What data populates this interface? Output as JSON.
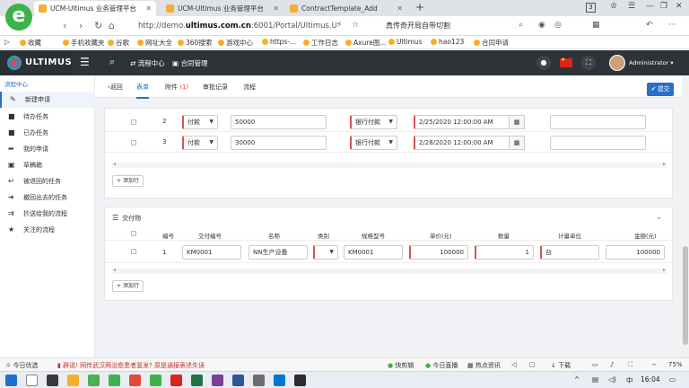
{
  "browser": {
    "tabs": [
      {
        "title": "UCM-Ultimus 业务管理平台",
        "active": true
      },
      {
        "title": "UCM-Ultimus 业务管理平台",
        "active": false
      },
      {
        "title": "ContractTemplate_Add",
        "active": false
      }
    ],
    "new_tab": "+",
    "tab_count": "3",
    "url_prefix": "http://demo.",
    "url_domain": "ultimus.com.cn",
    "url_rest": ":6001/Portal/Ultimus.U",
    "search_text": "真传奇开局自带切割",
    "bookmarks": [
      "收藏",
      "手机收藏夹",
      "谷歌",
      "网址大全",
      "360搜索",
      "游戏中心",
      "https-...",
      "工作日志",
      "Axure图...",
      "Ultimus",
      "hao123",
      "合同申请"
    ]
  },
  "header": {
    "logo_text": "ULTIMUS",
    "menu": [
      {
        "label": "流程中心",
        "icon": "shuffle-icon"
      },
      {
        "label": "合同管理",
        "icon": "folder-icon"
      }
    ],
    "user_name": "Administrator"
  },
  "sidebar": {
    "section_title": "流程中心",
    "items": [
      {
        "label": "新建申请",
        "icon": "edit-icon",
        "active": true
      },
      {
        "label": "待办任务",
        "icon": "briefcase-icon",
        "active": false
      },
      {
        "label": "已办任务",
        "icon": "briefcase-icon",
        "active": false
      },
      {
        "label": "我的申请",
        "icon": "share-icon",
        "active": false
      },
      {
        "label": "草稿箱",
        "icon": "save-icon",
        "active": false
      },
      {
        "label": "被退回的任务",
        "icon": "undo-icon",
        "active": false
      },
      {
        "label": "撤回出去的任务",
        "icon": "arrow-right-icon",
        "active": false
      },
      {
        "label": "抄送给我的流程",
        "icon": "forward-icon",
        "active": false
      },
      {
        "label": "关注的流程",
        "icon": "star-icon",
        "active": false
      }
    ]
  },
  "subnav": {
    "back": "返回",
    "tabs": [
      "表单",
      "附件",
      "审批记录",
      "流程"
    ],
    "attachment_badge": "(1)",
    "submit": "提交"
  },
  "payments": {
    "rows": [
      {
        "no": "2",
        "type": "付款",
        "amount": "50000",
        "method": "银行付款",
        "date": "2/25/2020 12:00:00 AM"
      },
      {
        "no": "3",
        "type": "付款",
        "amount": "30000",
        "method": "银行付款",
        "date": "2/28/2020 12:00:00 AM"
      }
    ],
    "add_row": "添加行"
  },
  "deliverables": {
    "title": "交付物",
    "columns": [
      "编号",
      "交付编号",
      "名称",
      "类别",
      "规格型号",
      "单价(元)",
      "数量",
      "计量单位",
      "金额(元)"
    ],
    "rows": [
      {
        "no": "1",
        "code": "KM0001",
        "name": "NN生产设备",
        "category": "",
        "spec": "KM0001",
        "unit_price": "100000",
        "qty": "1",
        "unit": "台",
        "amount": "100000"
      }
    ],
    "add_row": "添加行"
  },
  "statusbar": {
    "weather": "今日优选",
    "news": "辟谣! 网传武汉两治愈患者复发? 原是通报表述失误",
    "right_items": [
      "快剪辑",
      "今日直播",
      "热点资讯",
      "下载",
      "75%"
    ]
  },
  "taskbar": {
    "lang": "中",
    "time": "16:04"
  }
}
